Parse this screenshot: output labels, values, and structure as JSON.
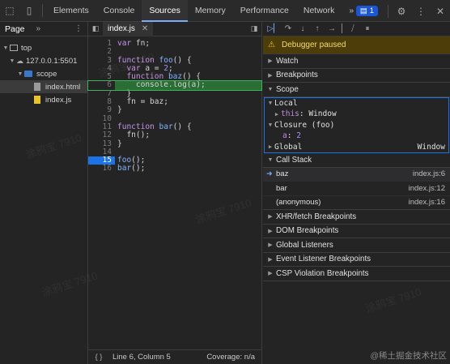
{
  "topbar": {
    "tabs": [
      "Elements",
      "Console",
      "Sources",
      "Memory",
      "Performance",
      "Network"
    ],
    "more": "»",
    "issues_count": "1"
  },
  "navigator": {
    "title": "Page",
    "more": "»",
    "tree": [
      {
        "label": "top",
        "level": 0
      },
      {
        "label": "127.0.0.1:5501",
        "level": 1
      },
      {
        "label": "scope",
        "level": 2
      },
      {
        "label": "index.html",
        "level": 3
      },
      {
        "label": "index.js",
        "level": 3
      }
    ]
  },
  "editor": {
    "tab": "index.js",
    "lines": [
      {
        "n": "1",
        "code": "var fn;"
      },
      {
        "n": "2",
        "code": ""
      },
      {
        "n": "3",
        "code": "function foo() {"
      },
      {
        "n": "4",
        "code": "  var a = 2;"
      },
      {
        "n": "5",
        "code": "  function baz() {"
      },
      {
        "n": "6",
        "code": "    console.log(a);"
      },
      {
        "n": "7",
        "code": "  }"
      },
      {
        "n": "8",
        "code": "  fn = baz;"
      },
      {
        "n": "9",
        "code": "}"
      },
      {
        "n": "10",
        "code": ""
      },
      {
        "n": "11",
        "code": "function bar() {"
      },
      {
        "n": "12",
        "code": "  fn();"
      },
      {
        "n": "13",
        "code": "}"
      },
      {
        "n": "14",
        "code": ""
      },
      {
        "n": "15",
        "code": "foo();"
      },
      {
        "n": "16",
        "code": "bar();"
      }
    ],
    "status_position": "Line 6, Column 5",
    "status_coverage": "Coverage: n/a"
  },
  "debugger": {
    "paused_text": "Debugger paused",
    "sections": {
      "watch": "Watch",
      "breakpoints": "Breakpoints",
      "scope": "Scope",
      "call_stack": "Call Stack",
      "xhr": "XHR/fetch Breakpoints",
      "dom": "DOM Breakpoints",
      "global_listeners": "Global Listeners",
      "event_listener": "Event Listener Breakpoints",
      "csp": "CSP Violation Breakpoints"
    },
    "scope": {
      "local": "Local",
      "this_key": "this",
      "this_val": "Window",
      "closure": "Closure (foo)",
      "a_key": "a",
      "a_val": "2",
      "global": "Global",
      "global_val": "Window"
    },
    "call_stack": [
      {
        "fn": "baz",
        "loc": "index.js:6"
      },
      {
        "fn": "bar",
        "loc": "index.js:12"
      },
      {
        "fn": "(anonymous)",
        "loc": "index.js:16"
      }
    ]
  },
  "watermark": [
    "涂鸦宝 7910",
    "涂鸦宝 7910",
    "涂鸦宝 7910",
    "涂鸦宝 7910",
    "涂鸦宝 7910"
  ],
  "corner_watermark": "@稀土掘金技术社区"
}
